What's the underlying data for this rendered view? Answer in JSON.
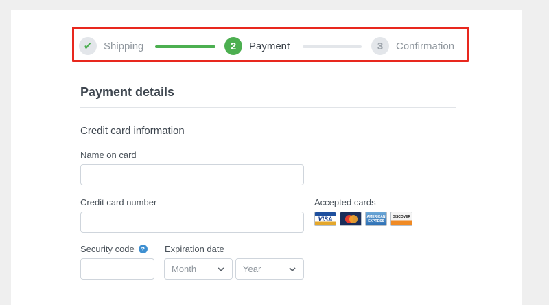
{
  "stepper": {
    "steps": [
      {
        "label": "Shipping",
        "marker": "✔",
        "state": "done"
      },
      {
        "label": "Payment",
        "marker": "2",
        "state": "active"
      },
      {
        "label": "Confirmation",
        "marker": "3",
        "state": "todo"
      }
    ]
  },
  "form": {
    "title": "Payment details",
    "subsection": "Credit card information",
    "name_on_card": {
      "label": "Name on card",
      "value": ""
    },
    "card_number": {
      "label": "Credit card number",
      "value": ""
    },
    "security_code": {
      "label": "Security code",
      "help_icon": "?",
      "value": ""
    },
    "expiration": {
      "label": "Expiration date",
      "month_selected": "Month",
      "year_selected": "Year"
    },
    "accepted_cards": {
      "label": "Accepted cards",
      "cards": [
        {
          "name": "visa-card-icon",
          "text": "VISA"
        },
        {
          "name": "mastercard-card-icon",
          "text": ""
        },
        {
          "name": "amex-card-icon",
          "text": "AMERICAN EXPRESS"
        },
        {
          "name": "discover-card-icon",
          "text": "DISCOVER"
        }
      ]
    }
  },
  "colors": {
    "accent_green": "#4caf50",
    "highlight_red": "#e8281e",
    "help_blue": "#3d8fd1"
  }
}
